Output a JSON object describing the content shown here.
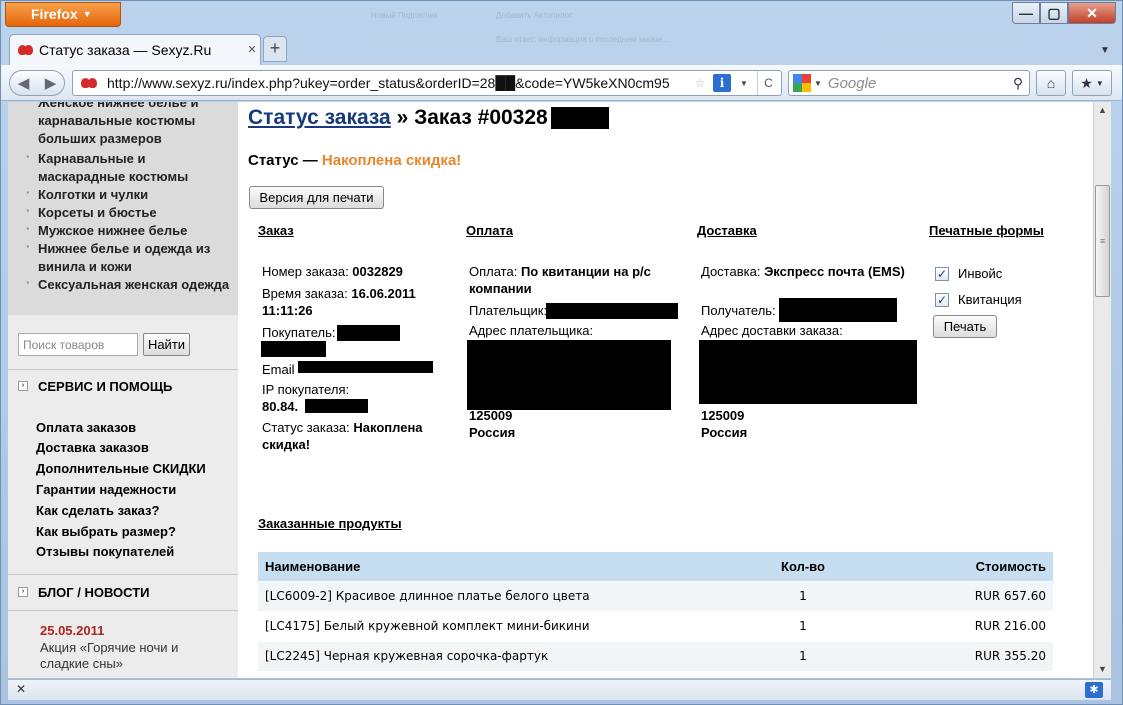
{
  "browser": {
    "menu_button": "Firefox",
    "window_buttons": {
      "minimize": "—",
      "maximize": "▢",
      "close": "✕"
    },
    "tab": {
      "title": "Статус заказа — Sexyz.Ru",
      "close": "✕"
    },
    "new_tab": "+",
    "back": "◀",
    "forward": "▶",
    "url": "http://www.sexyz.ru/index.php?ukey=order_status&orderID=28██&code=YW5keXN0cm95",
    "reload": "C",
    "search_placeholder": "Google",
    "home": "⌂",
    "status_close": "✕"
  },
  "notification_bg": [
    "Новый Подписчик",
    "Добавить Автопилот",
    "Ваш ответ: информация о последнем заказе..."
  ],
  "sidebar": {
    "categories": [
      "Женское нижнее белье и карнавальные костюмы больших размеров",
      "Карнавальные и маскарадные костюмы",
      "Колготки и чулки",
      "Корсеты и бюстье",
      "Мужское нижнее белье",
      "Нижнее белье и одежда из винила и кожи",
      "Сексуальная женская одежда"
    ],
    "search_placeholder": "Поиск товаров",
    "search_button": "Найти",
    "service_title": "СЕРВИС И ПОМОЩЬ",
    "service_links": [
      "Оплата заказов",
      "Доставка заказов",
      "Дополнительные СКИДКИ",
      "Гарантии надежности",
      "Как сделать заказ?",
      "Как выбрать размер?",
      "Отзывы покупателей"
    ],
    "blog_title": "БЛОГ / НОВОСТИ",
    "blog_date": "25.05.2011",
    "blog_text": "Акция «Горячие ночи и сладкие сны»"
  },
  "main": {
    "title_link": "Статус заказа",
    "title_sep": " » ",
    "title_order": "Заказ #00328",
    "status_label": "Статус — ",
    "status_value": "Накоплена скидка!",
    "print_version_button": "Версия для печати",
    "order": {
      "heading": "Заказ",
      "number_label": "Номер заказа: ",
      "number_value": "0032829",
      "time_label": "Время заказа: ",
      "time_value": "16.06.2011 11:11:26",
      "buyer_label": "Покупатель:",
      "email_label": "Email",
      "ip_label": "IP покупателя:",
      "ip_value": "80.84.",
      "status_label": "Статус заказа: ",
      "status_value": "Накоплена скидка!"
    },
    "payment": {
      "heading": "Оплата",
      "method_label": "Оплата: ",
      "method_value": "По квитанции на р/с компании",
      "payer_label": "Плательщик:",
      "address_label": "Адрес плательщика:",
      "zip": "125009",
      "country": "Россия"
    },
    "delivery": {
      "heading": "Доставка",
      "method_label": "Доставка: ",
      "method_value": "Экспресс почта (EMS)",
      "recipient_label": "Получатель:",
      "address_label": "Адрес доставки заказа:",
      "zip": "125009",
      "country": "Россия"
    },
    "print_forms": {
      "heading": "Печатные формы",
      "invoice": "Инвойс",
      "receipt": "Квитанция",
      "print_button": "Печать"
    },
    "products": {
      "heading": "Заказанные продукты",
      "columns": [
        "Наименование",
        "Кол-во",
        "Стоимость"
      ],
      "rows": [
        {
          "name": "[LC6009-2] Красивое длинное платье белого цвета",
          "qty": "1",
          "price": "RUR 657.60"
        },
        {
          "name": "[LC4175] Белый кружевной комплект мини-бикини",
          "qty": "1",
          "price": "RUR 216.00"
        },
        {
          "name": "[LC2245] Черная кружевная сорочка-фартук",
          "qty": "1",
          "price": "RUR 355.20"
        }
      ]
    }
  }
}
